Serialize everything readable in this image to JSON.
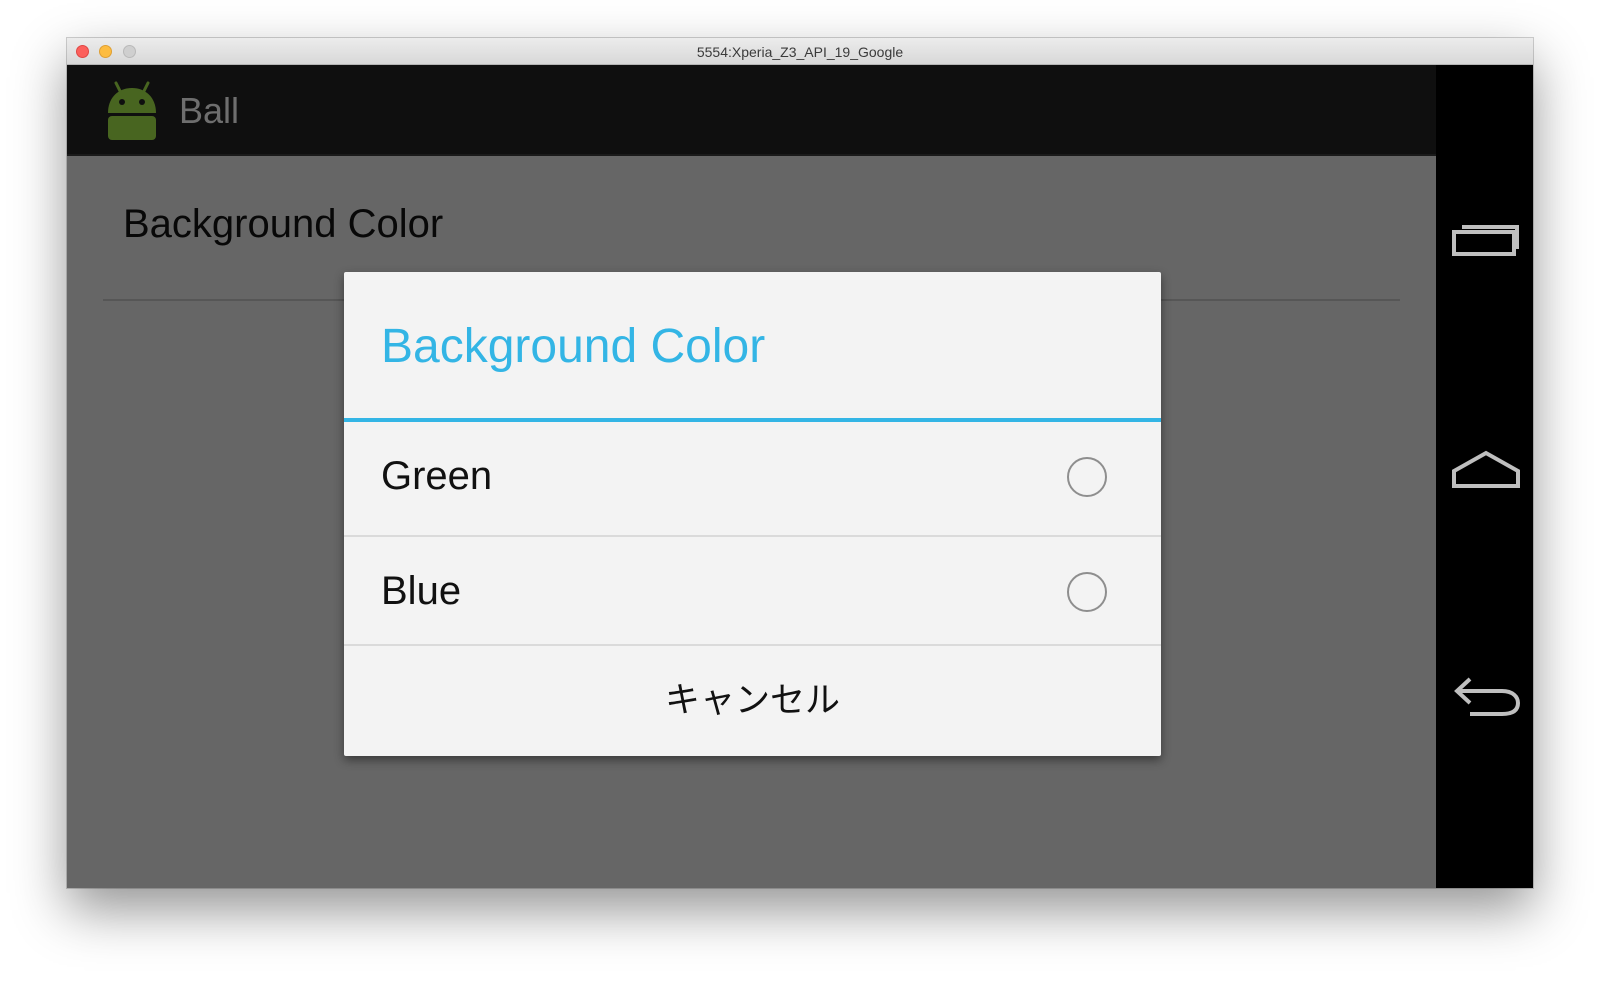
{
  "window": {
    "title": "5554:Xperia_Z3_API_19_Google"
  },
  "app": {
    "title": "Ball",
    "icon": "android-icon"
  },
  "preference": {
    "title": "Background Color"
  },
  "dialog": {
    "title": "Background Color",
    "options": [
      {
        "label": "Green",
        "selected": false
      },
      {
        "label": "Blue",
        "selected": false
      }
    ],
    "cancel_label": "キャンセル"
  },
  "nav_bar": {
    "buttons": [
      "recent-apps-icon",
      "home-icon",
      "back-icon"
    ]
  },
  "colors": {
    "accent": "#33b5e5",
    "dialog_bg": "#f3f3f3",
    "action_bar_bg": "#1f1f1f",
    "nav_bar_bg": "#000000"
  }
}
